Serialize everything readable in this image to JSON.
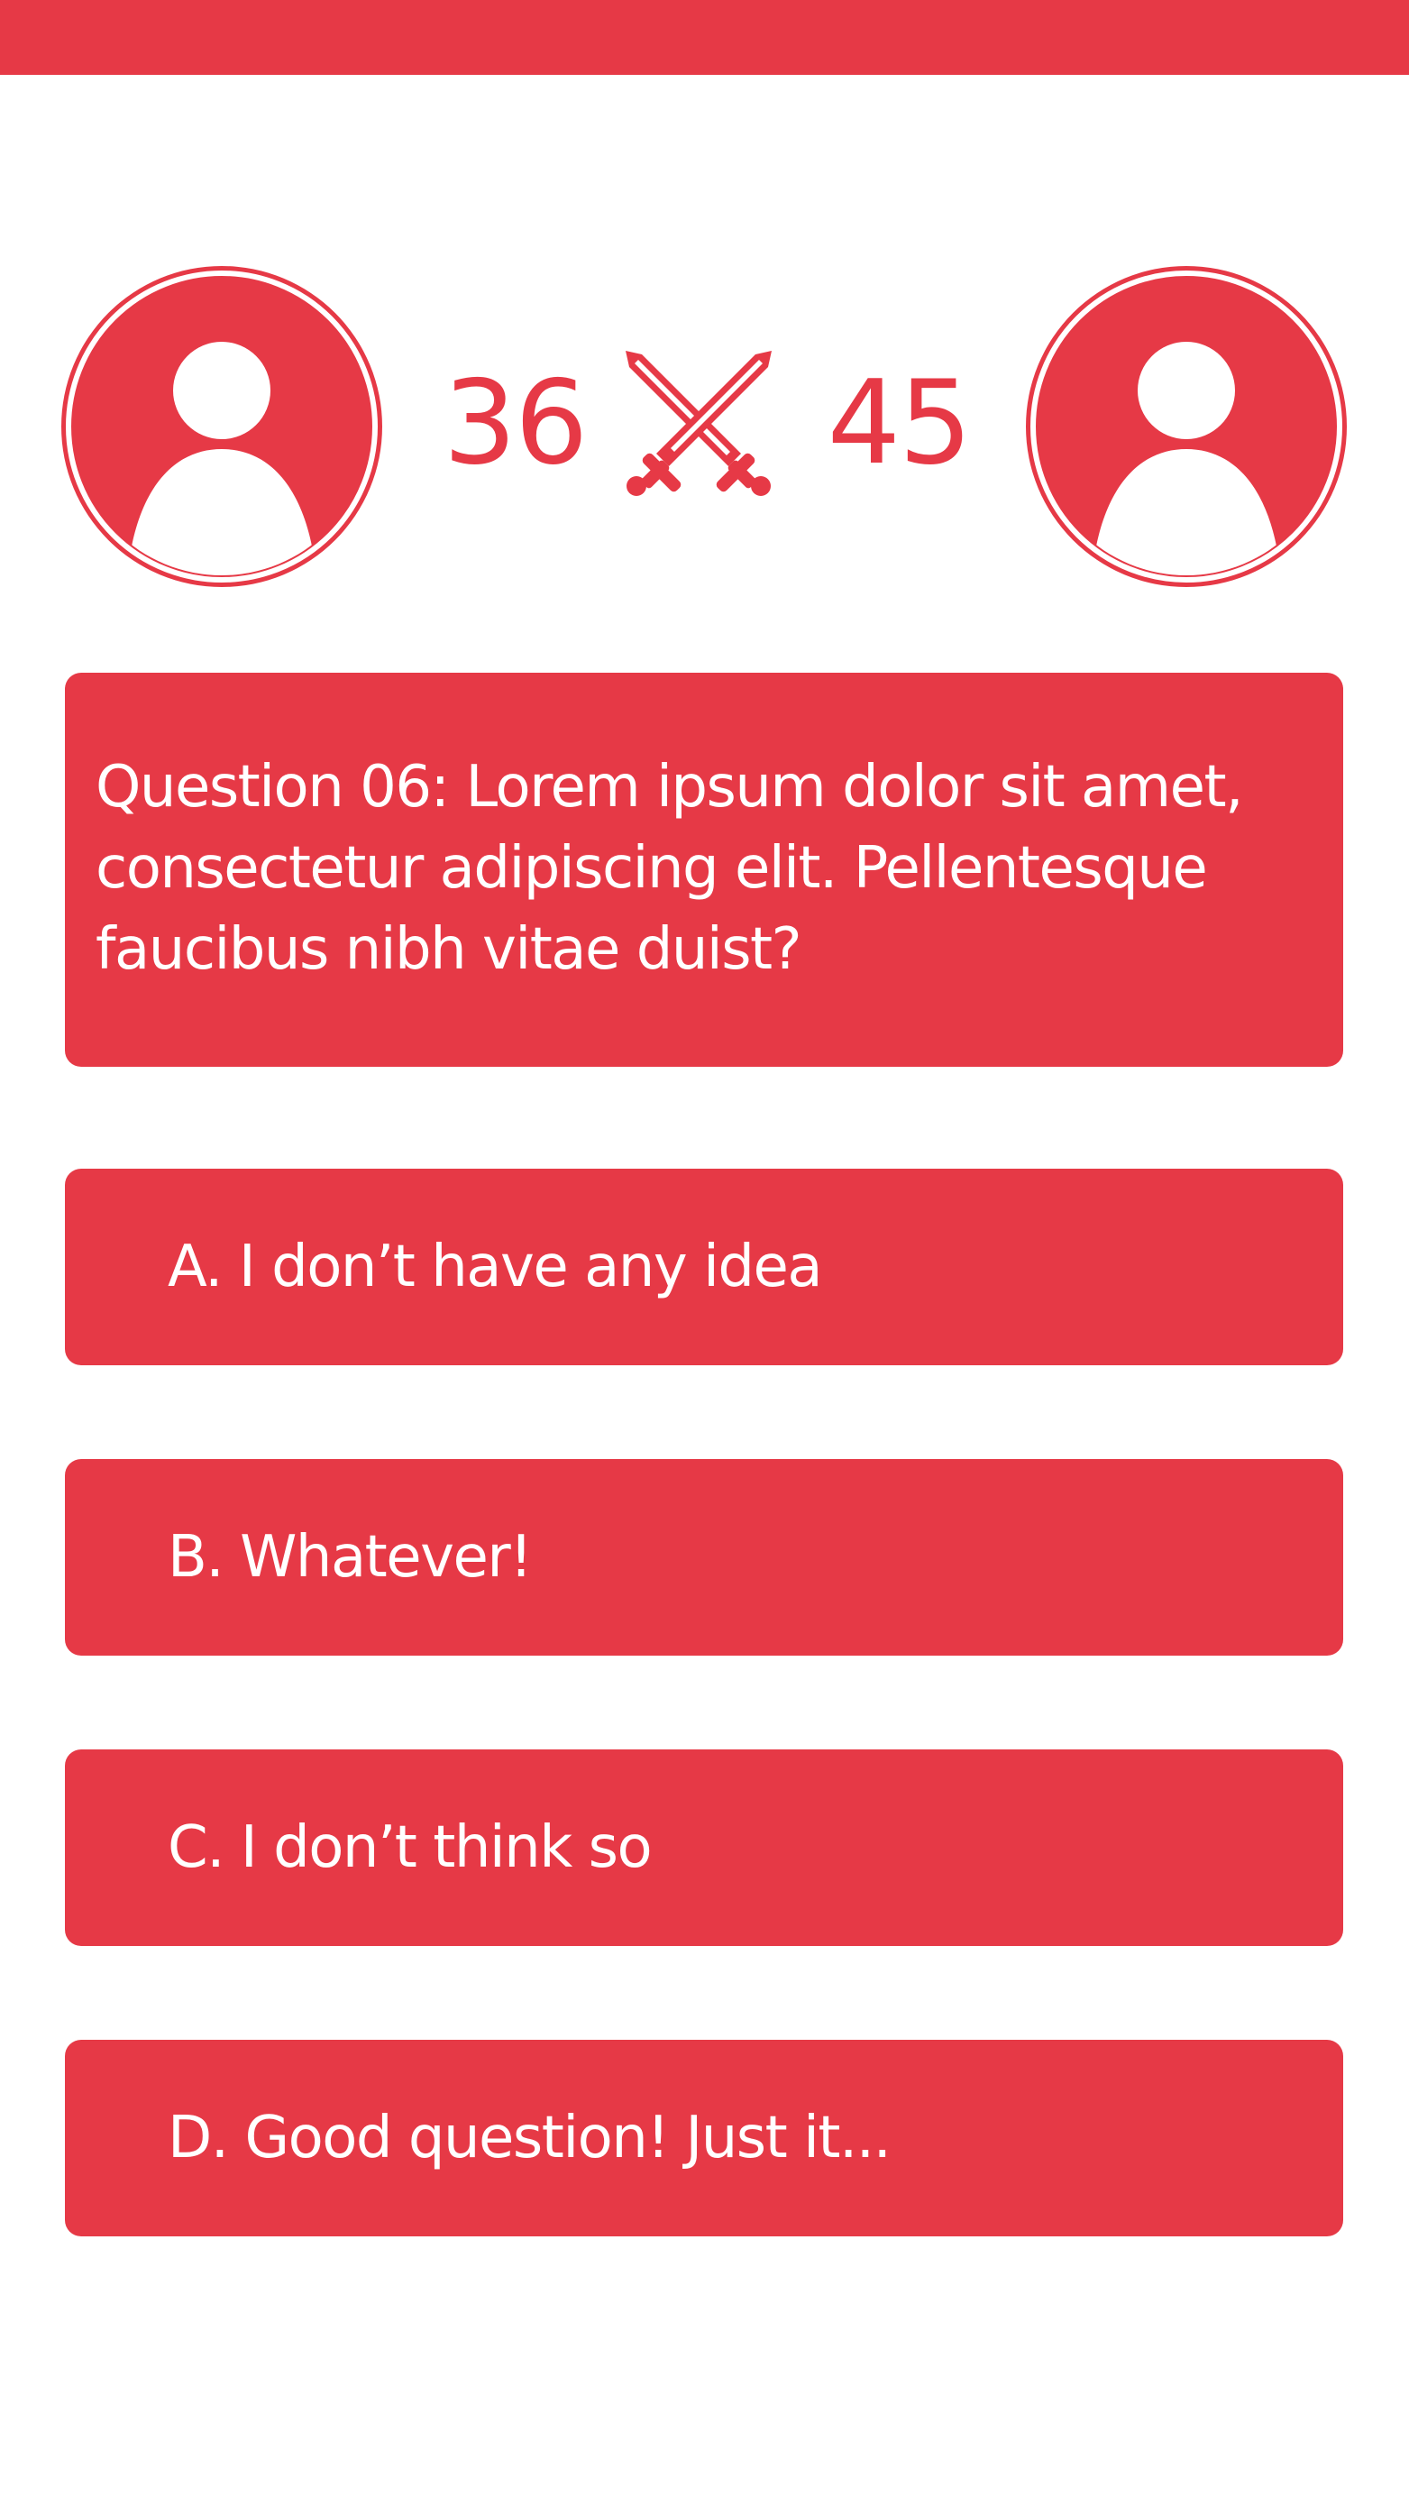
{
  "header": {
    "bar_color": "#E63946"
  },
  "players": {
    "left": {
      "avatar_icon": "user-avatar-icon",
      "score": "36"
    },
    "right": {
      "avatar_icon": "user-avatar-icon",
      "score": "45"
    },
    "versus_icon": "crossed-swords-icon"
  },
  "question": {
    "text": "Question 06: Lorem ipsum dolor sit amet, consectetur adipiscing elit. Pellentesque faucibus nibh vitae duist?"
  },
  "answers": [
    {
      "label": "A. I don’t have any idea"
    },
    {
      "label": "B. Whatever!"
    },
    {
      "label": "C. I don’t think so"
    },
    {
      "label": "D. Good question! Just it..."
    }
  ],
  "colors": {
    "accent": "#E63946",
    "text_on_accent": "#FFFFFF",
    "background": "#FFFFFF"
  }
}
